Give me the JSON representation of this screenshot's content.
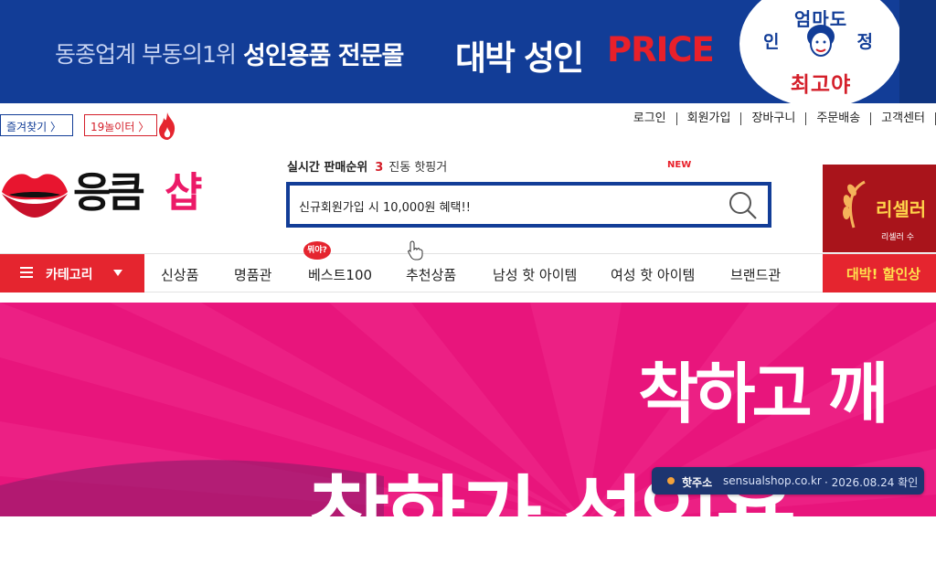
{
  "top_banner": {
    "left_text": "동종업계 부동의1위",
    "bold_text": "성인용품 전문몰",
    "big_text": "대박 성인",
    "price_text": "PRICE",
    "badge_line1": "엄마도",
    "badge_line2a": "인",
    "badge_line2b": "정",
    "badge_line3": "최고야"
  },
  "utility": {
    "favorite_label": "즐겨찾기 〉",
    "adult_label": "19놀이터 〉",
    "links": [
      "로그인",
      "회원가입",
      "장바구니",
      "주문배송",
      "고객센터"
    ]
  },
  "logo": {
    "text_black": "응큼",
    "text_pink": "샵"
  },
  "search": {
    "rank_label": "실시간 판매순위",
    "rank_number": "3",
    "rank_keyword": "진동 핫핑거",
    "new_tag": "NEW",
    "input_value": "신규회원가입 시 10,000원 혜택!!"
  },
  "side_promo": {
    "title": "리셀러",
    "subtitle": "리셀러 수"
  },
  "nav": {
    "category_label": "카테고리",
    "items": [
      "신상품",
      "명품관",
      "베스트100",
      "추천상품",
      "남성 핫 아이템",
      "여성 핫 아이템",
      "브랜드관"
    ],
    "best_badge": "뭐야?",
    "promo_label": "대박! 할인상"
  },
  "hero": {
    "line1": "착하고 깨",
    "line2": "착한가 성인용"
  },
  "address_toast": {
    "label": "핫주소",
    "url": "sensualshop.co.kr",
    "date": "· 2026.08.24 확인"
  },
  "colors": {
    "banner_blue": "#123d97",
    "brand_red": "#e5252f",
    "brand_pink": "#ec1a68",
    "hero_pink": "#e8157c"
  }
}
